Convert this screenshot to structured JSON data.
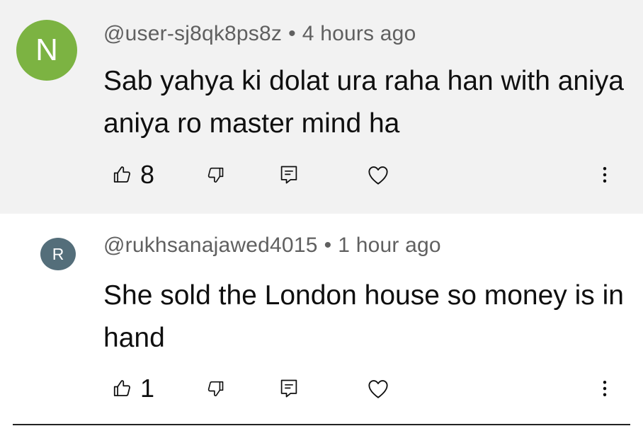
{
  "comments": [
    {
      "avatar_letter": "N",
      "avatar_color": "#7cb342",
      "username": "@user-sj8qk8ps8z",
      "separator": "•",
      "time": "4 hours ago",
      "text": "Sab yahya ki dolat ura raha han with aniya aniya ro master mind ha",
      "likes": "8",
      "background": "#f2f2f2"
    },
    {
      "avatar_letter": "R",
      "avatar_color": "#546e7a",
      "username": "@rukhsanajawed4015",
      "separator": "•",
      "time": "1 hour ago",
      "text": "She sold the London house so money is in hand",
      "likes": "1",
      "background": "#ffffff"
    }
  ],
  "icons": {
    "like": "thumbs-up-icon",
    "dislike": "thumbs-down-icon",
    "reply": "reply-comment-icon",
    "heart": "heart-icon",
    "more": "more-vertical-icon"
  }
}
